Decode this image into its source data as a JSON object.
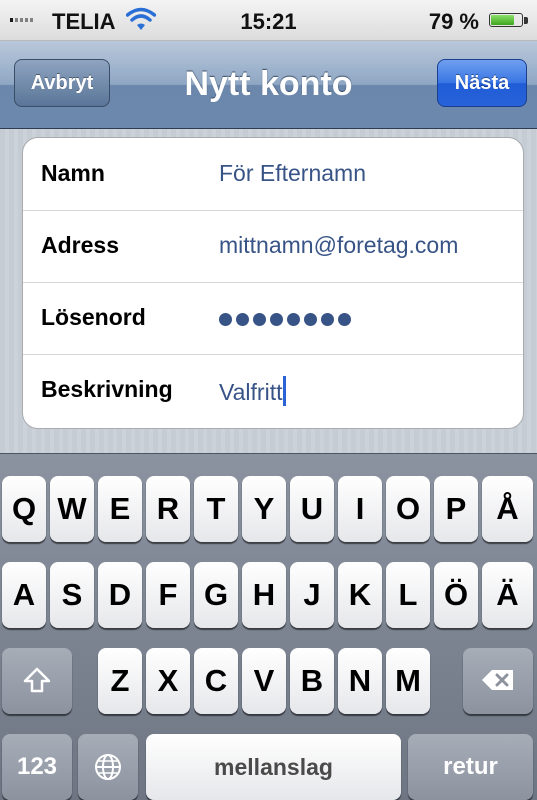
{
  "status_bar": {
    "carrier": "TELIA",
    "time": "15:21",
    "battery_percent": "79 %",
    "battery_level": 0.79,
    "signal_icon": "signal-bars-icon",
    "wifi_icon": "wifi-icon"
  },
  "nav": {
    "title": "Nytt konto",
    "cancel_label": "Avbryt",
    "next_label": "Nästa",
    "accent_color": "#2862d8"
  },
  "form": {
    "fields": [
      {
        "label": "Namn",
        "value": "För Efternamn"
      },
      {
        "label": "Adress",
        "value": "mittnamn@foretag.com"
      },
      {
        "label": "Lösenord",
        "value": "••••••••",
        "masked": true,
        "length": 8
      },
      {
        "label": "Beskrivning",
        "value": "Valfritt",
        "focused": true
      }
    ],
    "value_color": "#385487"
  },
  "keyboard": {
    "row1": [
      "Q",
      "W",
      "E",
      "R",
      "T",
      "Y",
      "U",
      "I",
      "O",
      "P",
      "Å"
    ],
    "row2": [
      "A",
      "S",
      "D",
      "F",
      "G",
      "H",
      "J",
      "K",
      "L",
      "Ö",
      "Ä"
    ],
    "row3": [
      "Z",
      "X",
      "C",
      "V",
      "B",
      "N",
      "M"
    ],
    "shift_icon": "shift-arrow-icon",
    "backspace_icon": "backspace-icon",
    "globe_icon": "globe-icon",
    "numbers_label": "123",
    "space_label": "mellanslag",
    "return_label": "retur"
  }
}
